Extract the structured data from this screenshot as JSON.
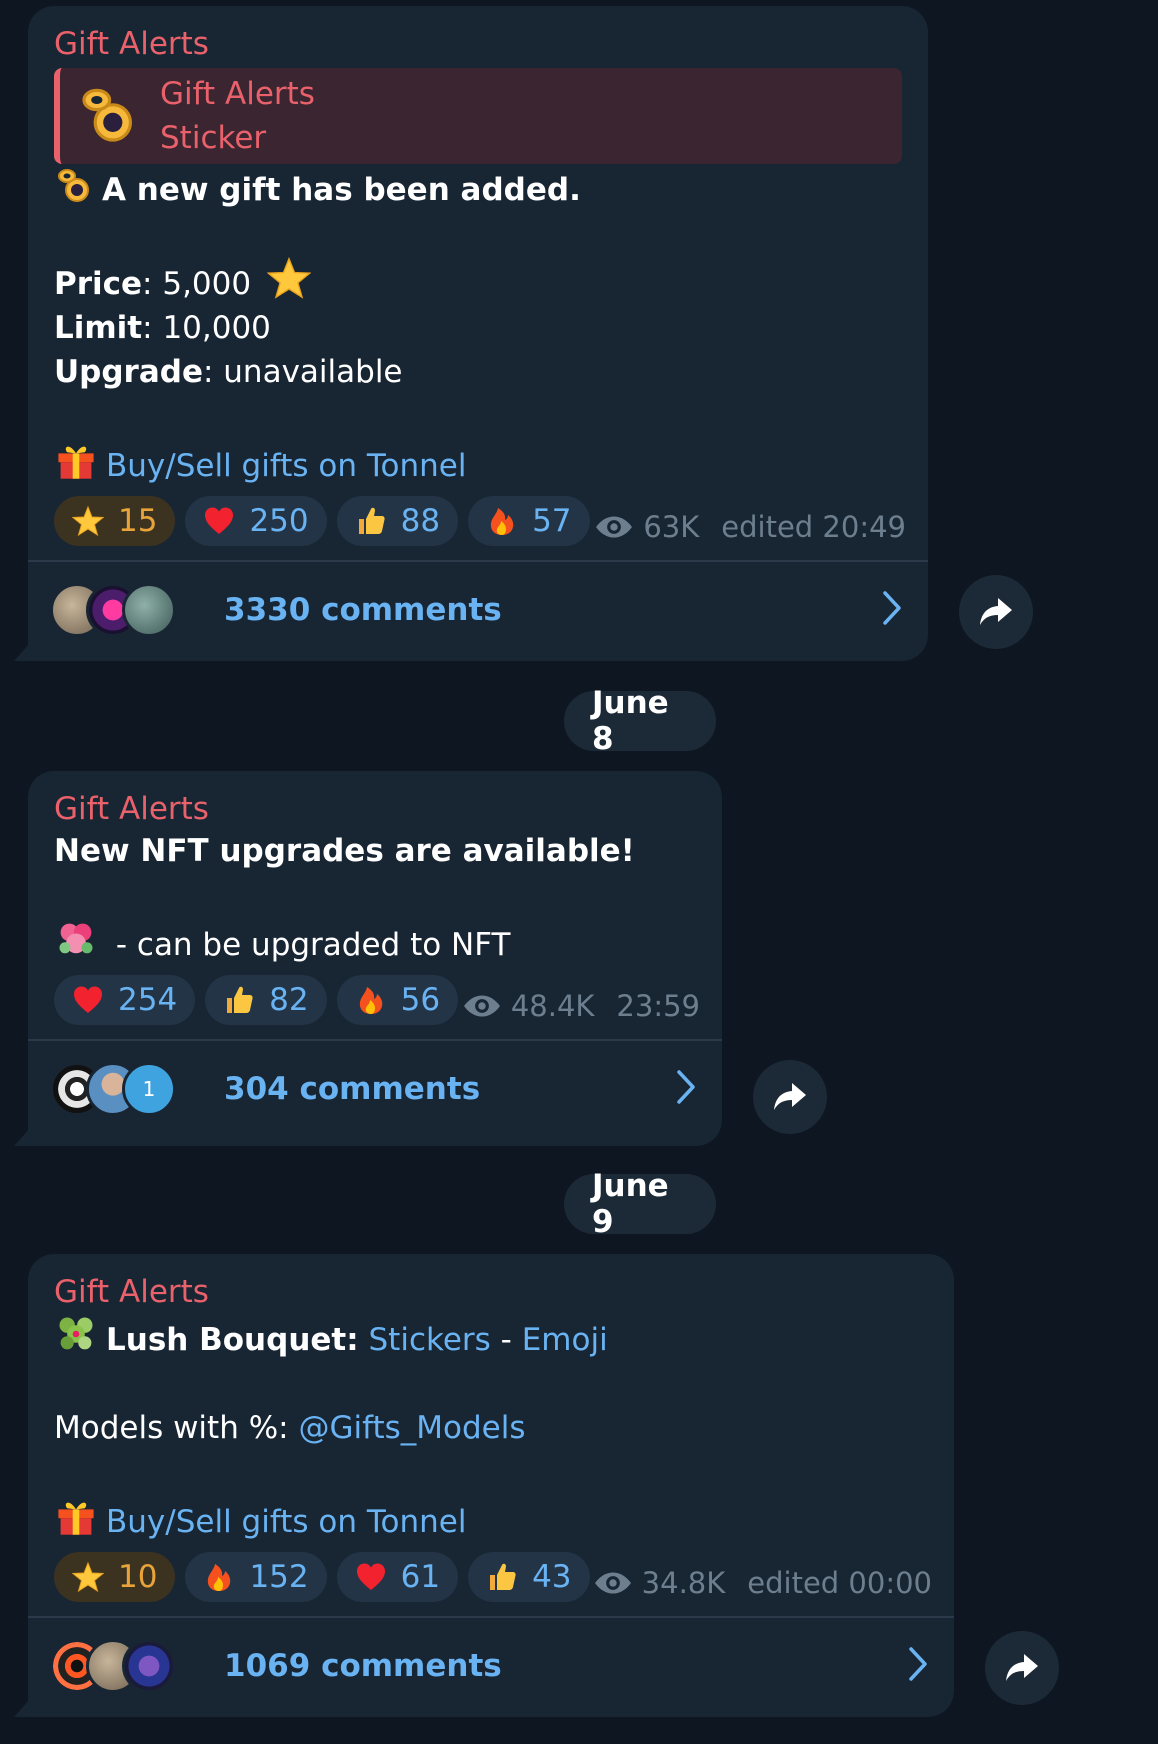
{
  "messages": [
    {
      "channel": "Gift Alerts",
      "reply": {
        "title": "Gift Alerts",
        "subtitle": "Sticker"
      },
      "headline": "A new gift has been added.",
      "price_label": "Price",
      "price_value": ": 5,000",
      "limit_label": "Limit",
      "limit_value": ": 10,000",
      "upgrade_label": "Upgrade",
      "upgrade_value": ": unavailable",
      "link": "Buy/Sell gifts on Tonnel",
      "reactions": [
        {
          "emoji": "star-icon",
          "count": "15"
        },
        {
          "emoji": "heart-icon",
          "count": "250"
        },
        {
          "emoji": "thumbs-up-icon",
          "count": "88"
        },
        {
          "emoji": "fire-icon",
          "count": "57"
        }
      ],
      "views": "63K",
      "time": "edited 20:49",
      "comments": "3330 comments"
    },
    {
      "channel": "Gift Alerts",
      "headline": "New NFT upgrades are available!",
      "body": " - can be upgraded to NFT",
      "reactions": [
        {
          "emoji": "heart-icon",
          "count": "254"
        },
        {
          "emoji": "thumbs-up-icon",
          "count": "82"
        },
        {
          "emoji": "fire-icon",
          "count": "56"
        }
      ],
      "views": "48.4K",
      "time": "23:59",
      "comments": "304 comments",
      "avatar_badge": "1"
    },
    {
      "channel": "Gift Alerts",
      "title_bold": "Lush Bouquet:",
      "stickers_link": "Stickers",
      "dash": " - ",
      "emoji_link": "Emoji",
      "models_text": "Models with %: ",
      "models_link": "@Gifts_Models",
      "link": "Buy/Sell gifts on Tonnel",
      "reactions": [
        {
          "emoji": "star-icon",
          "count": "10"
        },
        {
          "emoji": "fire-icon",
          "count": "152"
        },
        {
          "emoji": "heart-icon",
          "count": "61"
        },
        {
          "emoji": "thumbs-up-icon",
          "count": "43"
        }
      ],
      "views": "34.8K",
      "time": "edited 00:00",
      "comments": "1069 comments"
    }
  ],
  "dates": [
    "June 8",
    "June 9"
  ],
  "colors": {
    "background": "#0e1621",
    "bubble": "#182533",
    "channel_name": "#e8616b",
    "link": "#6ab3f3",
    "star_reaction": "#e9a33b"
  }
}
